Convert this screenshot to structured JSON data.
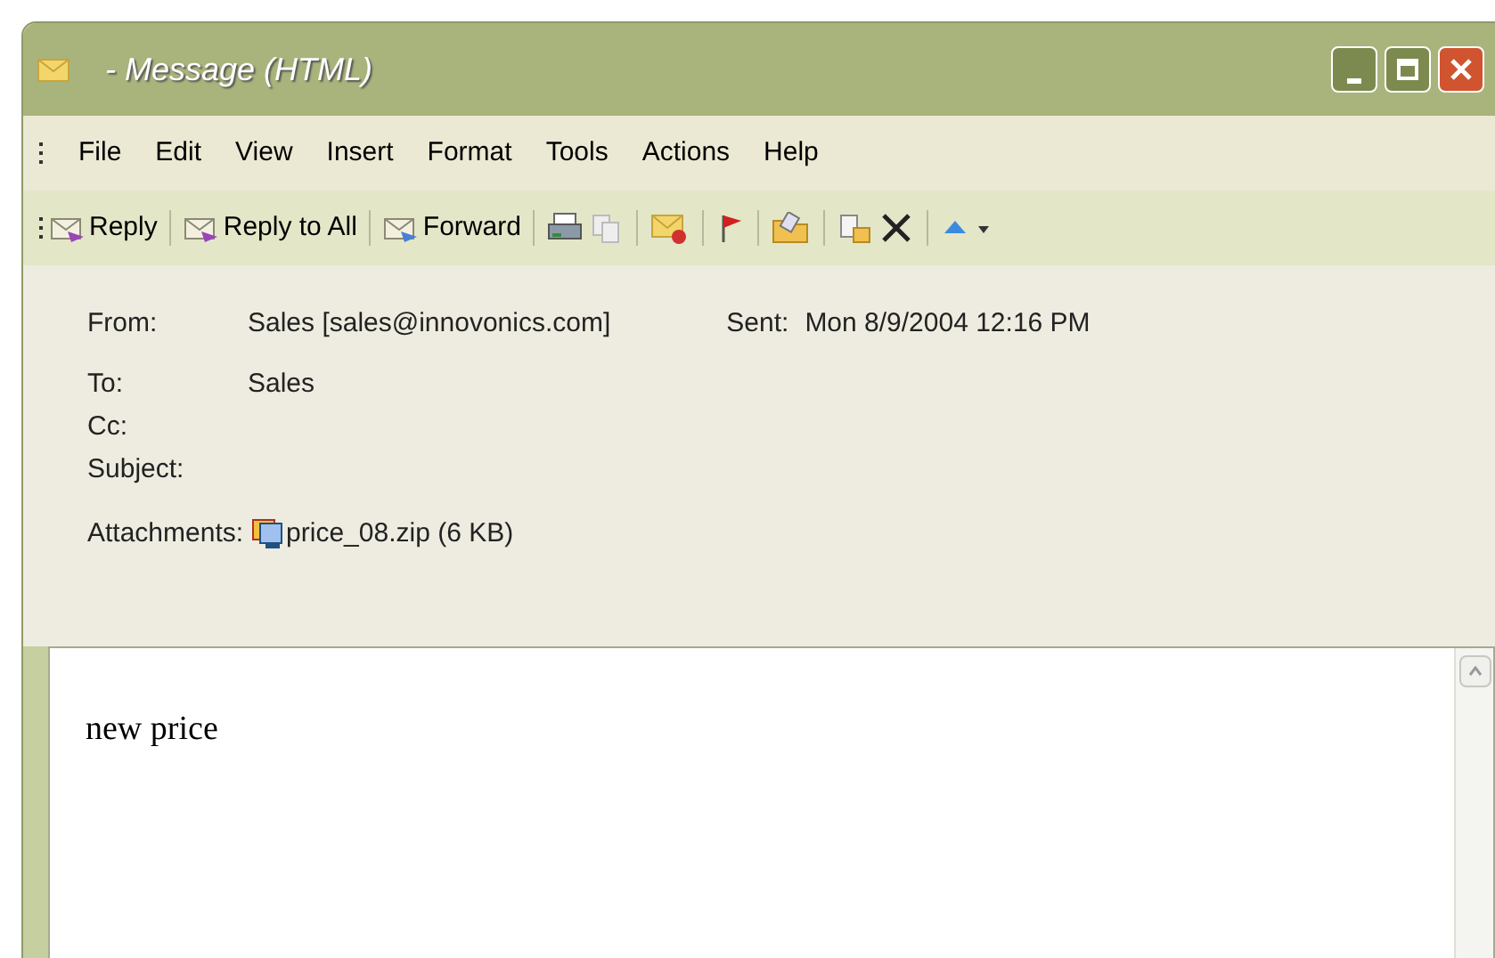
{
  "window": {
    "title": "- Message (HTML)"
  },
  "menu": [
    "File",
    "Edit",
    "View",
    "Insert",
    "Format",
    "Tools",
    "Actions",
    "Help"
  ],
  "toolbar": [
    "Reply",
    "Reply to All",
    "Forward"
  ],
  "header": {
    "fields": [
      {
        "label": "From:",
        "value": "Sales [sales@innovonics.com]"
      },
      {
        "label": "To:",
        "value": "Sales"
      },
      {
        "label": "Cc:"
      },
      {
        "label": "Subject:"
      }
    ],
    "sent": {
      "label": "Sent:",
      "value": "Mon 8/9/2004 12:16 PM"
    },
    "attachments": {
      "label": "Attachments:",
      "file": "price_08.zip (6 KB)"
    }
  },
  "body": {
    "text": "new price"
  }
}
